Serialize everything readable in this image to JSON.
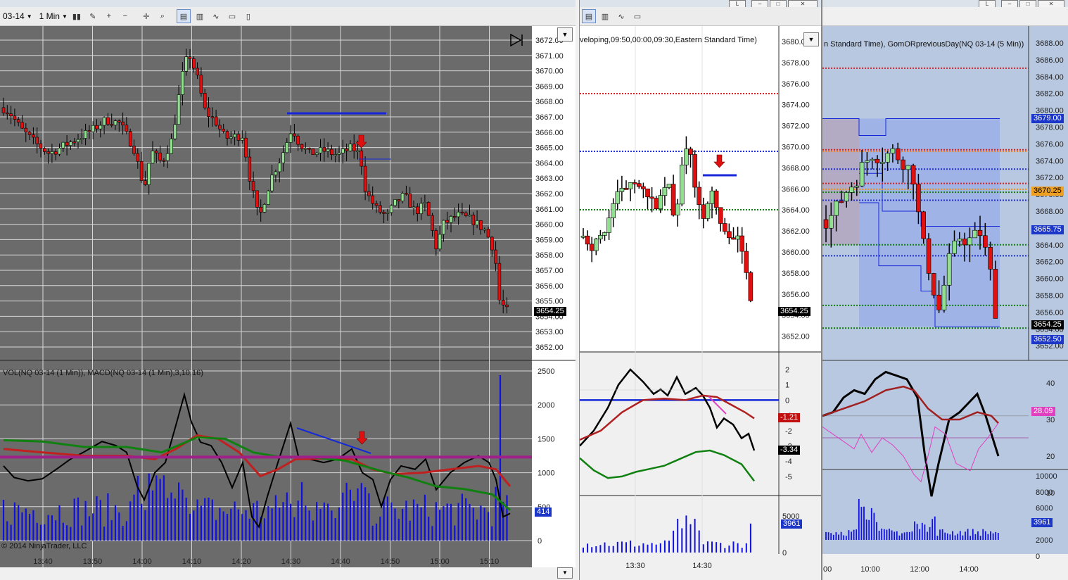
{
  "window1": {
    "instrument": "03-14",
    "period": "1 Min",
    "indicator_title": "VOL(NQ 03-14 (1 Min)), MACD(NQ 03-14 (1 Min),3,10,16)",
    "copyright": "© 2014 NinjaTrader, LLC",
    "last_price": "3654.25",
    "volume_tag": "414",
    "price_labels": [
      "3672.00",
      "3671.00",
      "3670.00",
      "3669.00",
      "3668.00",
      "3667.00",
      "3666.00",
      "3665.00",
      "3664.00",
      "3663.00",
      "3662.00",
      "3661.00",
      "3660.00",
      "3659.00",
      "3658.00",
      "3657.00",
      "3656.00",
      "3655.00",
      "3654.00",
      "3653.00",
      "3652.00"
    ],
    "ind_labels": [
      "2500",
      "2000",
      "1500",
      "1000",
      "500",
      "0"
    ],
    "time_labels": [
      "13:40",
      "13:50",
      "14:00",
      "14:10",
      "14:20",
      "14:30",
      "14:40",
      "14:50",
      "15:00",
      "15:10"
    ]
  },
  "window2": {
    "header": "veloping,09:50,00:00,09:30,Eastern Standard Time)",
    "last_price": "3654.25",
    "price_labels": [
      "3680.00",
      "3678.00",
      "3676.00",
      "3674.00",
      "3672.00",
      "3670.00",
      "3668.00",
      "3666.00",
      "3664.00",
      "3662.00",
      "3660.00",
      "3658.00",
      "3656.00",
      "3654.00",
      "3652.00"
    ],
    "macd_labels": [
      "2",
      "1",
      "0",
      "-1",
      "-2",
      "-3",
      "-4",
      "-5"
    ],
    "macd_tag1": "-1.21",
    "macd_tag2": "-3.34",
    "vol_labels": [
      "5000",
      "0"
    ],
    "vol_tag": "3961",
    "time_labels": [
      "13:30",
      "14:30"
    ]
  },
  "window3": {
    "header": "n Standard Time), GomORpreviousDay(NQ 03-14 (5 Min))",
    "price_labels": [
      "3688.00",
      "3686.00",
      "3684.00",
      "3682.00",
      "3680.00",
      "3678.00",
      "3676.00",
      "3674.00",
      "3672.00",
      "3670.00",
      "3668.00",
      "3666.00",
      "3664.00",
      "3662.00",
      "3660.00",
      "3658.00",
      "3656.00",
      "3654.00",
      "3652.00"
    ],
    "tags": [
      "3679.00",
      "3670.25",
      "3665.75",
      "3654.25",
      "3652.50"
    ],
    "osc_labels": [
      "40",
      "30",
      "20",
      "10"
    ],
    "osc_tag": "28.09",
    "vol_labels": [
      "10000",
      "8000",
      "6000",
      "4000",
      "2000",
      "0"
    ],
    "vol_tag": "3961",
    "time_labels": [
      "10:00",
      "12:00",
      "14:00"
    ],
    "cut_time_label": "00"
  },
  "colors": {
    "bull": "#90e090",
    "bear": "#e01010",
    "macd": "#000000",
    "signal": "#b02020",
    "slow": "#108010",
    "volume": "#1010e0",
    "magenta": "#a0208a"
  }
}
